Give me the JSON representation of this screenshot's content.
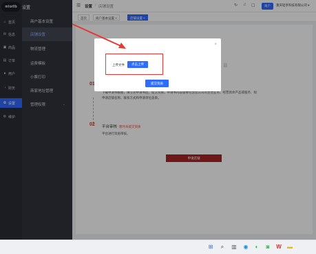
{
  "logo": {
    "text": "m!ori!b"
  },
  "nav": {
    "items": [
      {
        "icon": "home-icon",
        "glyph": "⌂",
        "label": "首页"
      },
      {
        "icon": "message-icon",
        "glyph": "✉",
        "label": "信息"
      },
      {
        "icon": "goods-icon",
        "glyph": "▣",
        "label": "商品"
      },
      {
        "icon": "order-icon",
        "glyph": "▤",
        "label": "订单"
      },
      {
        "icon": "user-icon",
        "glyph": "●",
        "label": "用户"
      },
      {
        "icon": "finance-icon",
        "glyph": "◔",
        "label": "财务"
      },
      {
        "icon": "settings-icon",
        "glyph": "✿",
        "label": "设置"
      },
      {
        "icon": "maintain-icon",
        "glyph": "⚙",
        "label": "维护"
      }
    ]
  },
  "subnav": {
    "title": "设置",
    "items": [
      {
        "label": "商户基本设置"
      },
      {
        "label": "店铺设置"
      },
      {
        "label": "物流管理"
      },
      {
        "label": "运费模板"
      },
      {
        "label": "小票打印"
      },
      {
        "label": "商家地址管理"
      },
      {
        "label": "管理权限"
      }
    ]
  },
  "header": {
    "title": "设置",
    "separator": "/",
    "crumb": "店铺设置",
    "icons": [
      "refresh-icon",
      "bell-icon",
      "fullscreen-icon"
    ],
    "tag": "商户",
    "company": "重庆轻享科技有限公司 ▾"
  },
  "tabs": [
    {
      "label": "首页"
    },
    {
      "label": "商户基本设置 ×"
    },
    {
      "label": "店铺设置 ×"
    }
  ],
  "steps": [
    {
      "num": "01",
      "text1": "下载申请书模板，填写完申请书后，提交资质。申请书内容需要包含您公司的主营业务、经营具体产品或服务、拟",
      "text2": "申请店铺名称、联系方式和申请单位盖章。"
    },
    {
      "num": "02",
      "title": "平台审核",
      "hint": "暂时未提交资质",
      "text1": "平台进行资质审核。"
    }
  ],
  "apply_button": "申请店铺",
  "modal": {
    "close": "×",
    "upload_label": "上传文件",
    "upload_button": "点击上传",
    "submit_button": "提交资质",
    "side_text": "园"
  },
  "colors": {
    "accent": "#2f6bff",
    "annotation": "#e53935",
    "apply": "#a82424",
    "sidebar": "#2a2d36"
  }
}
